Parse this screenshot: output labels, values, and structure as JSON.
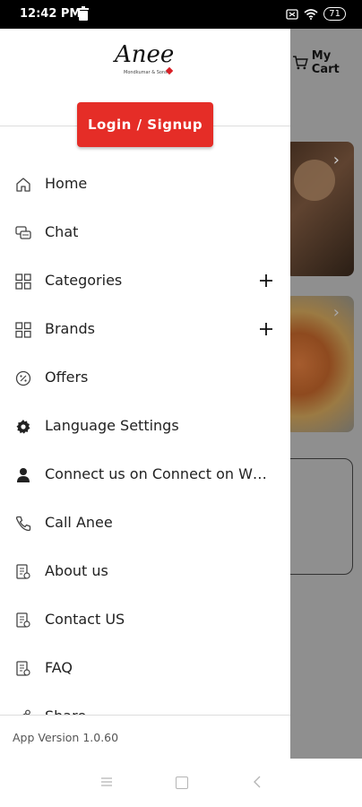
{
  "status_bar": {
    "time": "12:42 PM",
    "battery": "71"
  },
  "background": {
    "cart_label": "My Cart"
  },
  "drawer": {
    "brand": {
      "logo_text": "Anee",
      "logo_subtext": "Mondkumar & Sons"
    },
    "login_label": "Login / Signup",
    "menu": [
      {
        "label": "Home",
        "icon": "home-icon"
      },
      {
        "label": "Chat",
        "icon": "chat-icon"
      },
      {
        "label": "Categories",
        "icon": "grid-icon",
        "expandable": true
      },
      {
        "label": "Brands",
        "icon": "grid-icon",
        "expandable": true
      },
      {
        "label": "Offers",
        "icon": "offers-icon"
      },
      {
        "label": "Language Settings",
        "icon": "settings-icon"
      },
      {
        "label": "Connect us on Connect on Whats...",
        "icon": "person-icon"
      },
      {
        "label": "Call Anee",
        "icon": "phone-icon"
      },
      {
        "label": "About us",
        "icon": "document-icon"
      },
      {
        "label": "Contact US",
        "icon": "document-icon"
      },
      {
        "label": "FAQ",
        "icon": "document-icon"
      },
      {
        "label": "Share",
        "icon": "share-icon"
      }
    ],
    "version": "App Version 1.0.60"
  }
}
